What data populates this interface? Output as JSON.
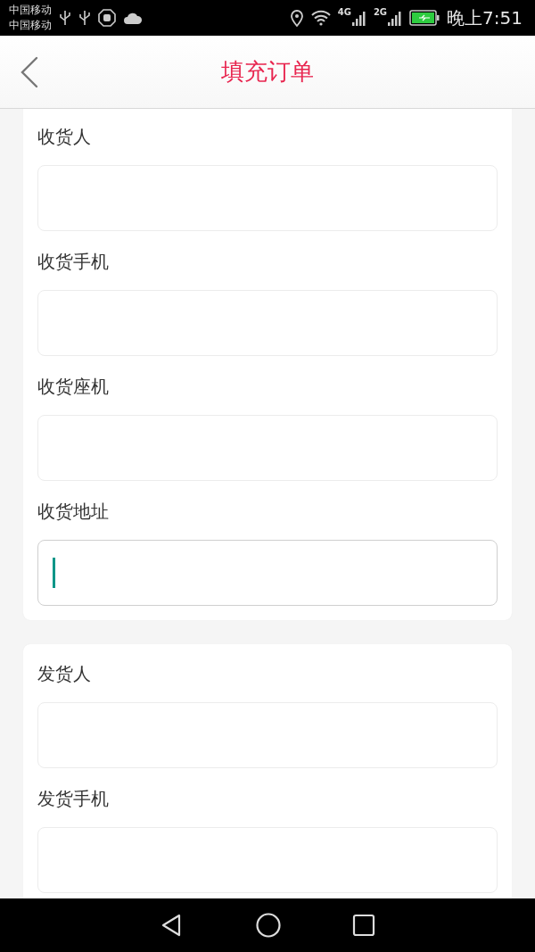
{
  "status_bar": {
    "carriers": [
      "中国移动",
      "中国移动"
    ],
    "network_1": "4G",
    "network_2": "2G",
    "time": "晚上7:51"
  },
  "header": {
    "title": "填充订单"
  },
  "sections": [
    {
      "fields": [
        {
          "label": "收货人",
          "focused": false
        },
        {
          "label": "收货手机",
          "focused": false
        },
        {
          "label": "收货座机",
          "focused": false
        },
        {
          "label": "收货地址",
          "focused": true
        }
      ]
    },
    {
      "fields": [
        {
          "label": "发货人",
          "focused": false
        },
        {
          "label": "发货手机",
          "focused": false
        }
      ]
    }
  ]
}
